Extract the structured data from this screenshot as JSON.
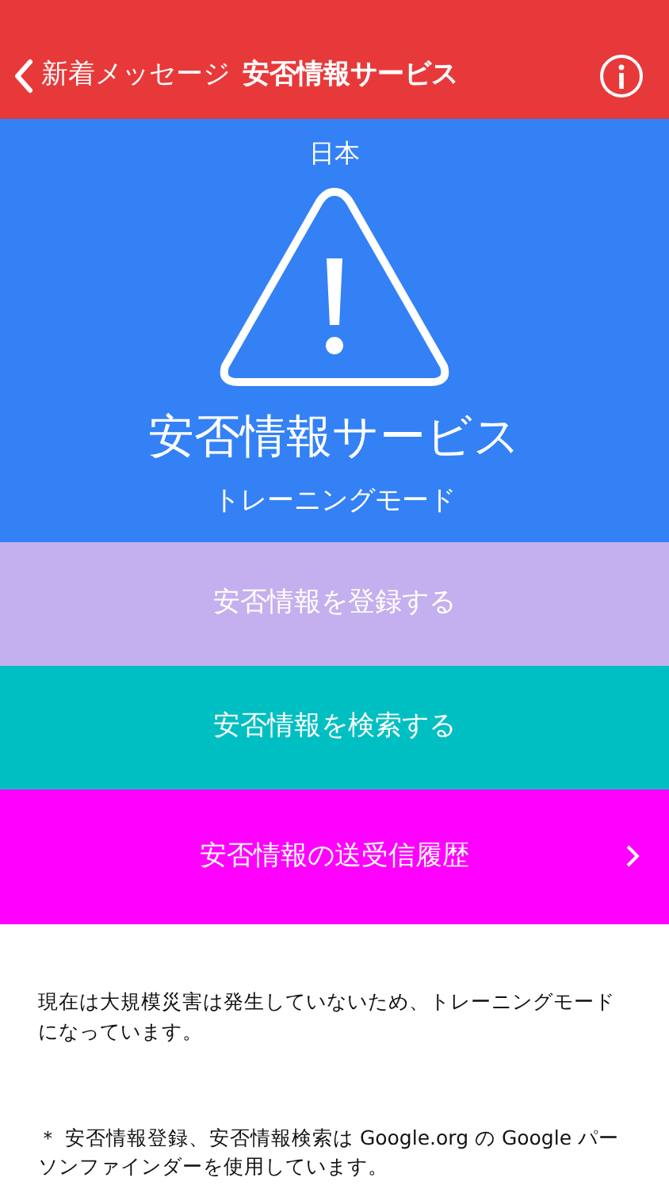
{
  "nav_bar": {
    "back_label": "新着メッセージ",
    "title": "安否情報サービス"
  },
  "hero": {
    "region": "日本",
    "title": "安否情報サービス",
    "subtitle": "トレーニングモード"
  },
  "menu": [
    {
      "label": "安否情報を登録する",
      "color": "#c4b0ee",
      "kind": "action"
    },
    {
      "label": "安否情報を検索する",
      "color": "#00bfc2",
      "kind": "action"
    },
    {
      "label": "安否情報の送受信履歴",
      "color": "#ff00ff",
      "kind": "link"
    }
  ],
  "notice": "現在は大規模災害は発生していないため、トレーニングモードになっています。",
  "footnote": "＊ 安否情報登録、安否情報検索は Google.org の Google パーソンファインダーを使用しています。"
}
